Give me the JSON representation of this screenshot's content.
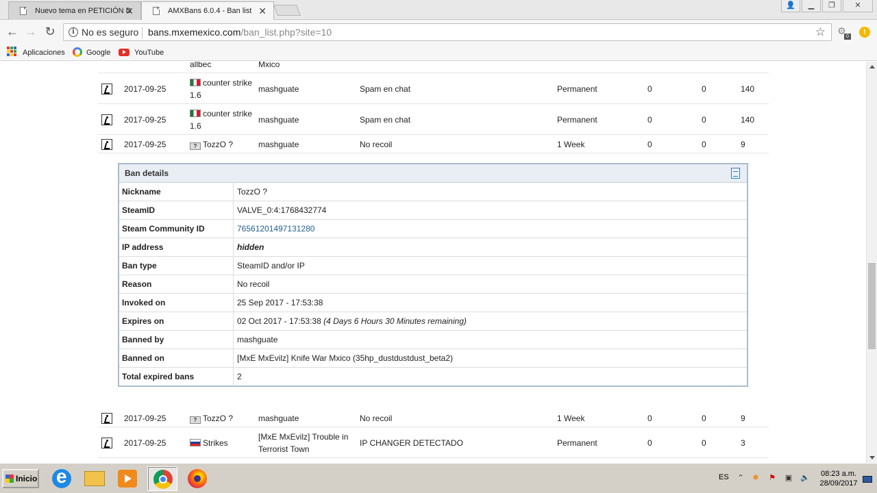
{
  "browser": {
    "tabs": [
      {
        "title": "Nuevo tema en PETICIÓN D"
      },
      {
        "title": "AMXBans 6.0.4 - Ban list"
      }
    ],
    "security_label": "No es seguro",
    "url_host": "bans.mxemexico.com",
    "url_path": "/ban_list.php?site=10",
    "extension_badge": "0",
    "bookmarks": [
      {
        "label": "Aplicaciones"
      },
      {
        "label": "Google"
      },
      {
        "label": "YouTube"
      }
    ]
  },
  "ban_list": {
    "partial_row": {
      "player": "allbec",
      "admin": "Mxico"
    },
    "rows_before": [
      {
        "date": "2017-09-25",
        "flag": "mx",
        "player": "counter strike 1.6",
        "admin": "mashguate",
        "reason": "Spam en chat",
        "length": "Permanent",
        "n1": "0",
        "n2": "0",
        "n3": "140"
      },
      {
        "date": "2017-09-25",
        "flag": "mx",
        "player": "counter strike 1.6",
        "admin": "mashguate",
        "reason": "Spam en chat",
        "length": "Permanent",
        "n1": "0",
        "n2": "0",
        "n3": "140"
      },
      {
        "date": "2017-09-25",
        "flag": "unknown",
        "player": "TozzO ?",
        "admin": "mashguate",
        "reason": "No recoil",
        "length": "1 Week",
        "n1": "0",
        "n2": "0",
        "n3": "9"
      }
    ],
    "rows_after": [
      {
        "date": "2017-09-25",
        "flag": "unknown",
        "player": "TozzO ?",
        "admin": "mashguate",
        "reason": "No recoil",
        "length": "1 Week",
        "n1": "0",
        "n2": "0",
        "n3": "9"
      },
      {
        "date": "2017-09-25",
        "flag": "ru",
        "player": "Strikes",
        "admin": "[MxE MxEvilz] Trouble in Terrorist Town",
        "reason": "IP CHANGER DETECTADO",
        "length": "Permanent",
        "n1": "0",
        "n2": "0",
        "n3": "3"
      }
    ]
  },
  "ban_details": {
    "title": "Ban details",
    "rows": [
      {
        "label": "Nickname",
        "value": "TozzO ?"
      },
      {
        "label": "SteamID",
        "value": "VALVE_0:4:1768432774"
      },
      {
        "label": "Steam Community ID",
        "value": "76561201497131280"
      },
      {
        "label": "IP address",
        "value": "hidden"
      },
      {
        "label": "Ban type",
        "value": "SteamID and/or IP"
      },
      {
        "label": "Reason",
        "value": "No recoil"
      },
      {
        "label": "Invoked on",
        "value": "25 Sep 2017 - 17:53:38"
      },
      {
        "label": "Expires on",
        "value": "02 Oct 2017 - 17:53:38",
        "remaining": "(4 Days 6 Hours 30 Minutes remaining)"
      },
      {
        "label": "Banned by",
        "value": "mashguate"
      },
      {
        "label": "Banned on",
        "value": "[MxE MxEvilz] Knife War Mxico (35hp_dustdustdust_beta2)"
      },
      {
        "label": "Total expired bans",
        "value": "2"
      }
    ]
  },
  "taskbar": {
    "start_label": "Inicio",
    "language": "ES",
    "time": "08:23 a.m.",
    "date": "28/09/2017"
  }
}
